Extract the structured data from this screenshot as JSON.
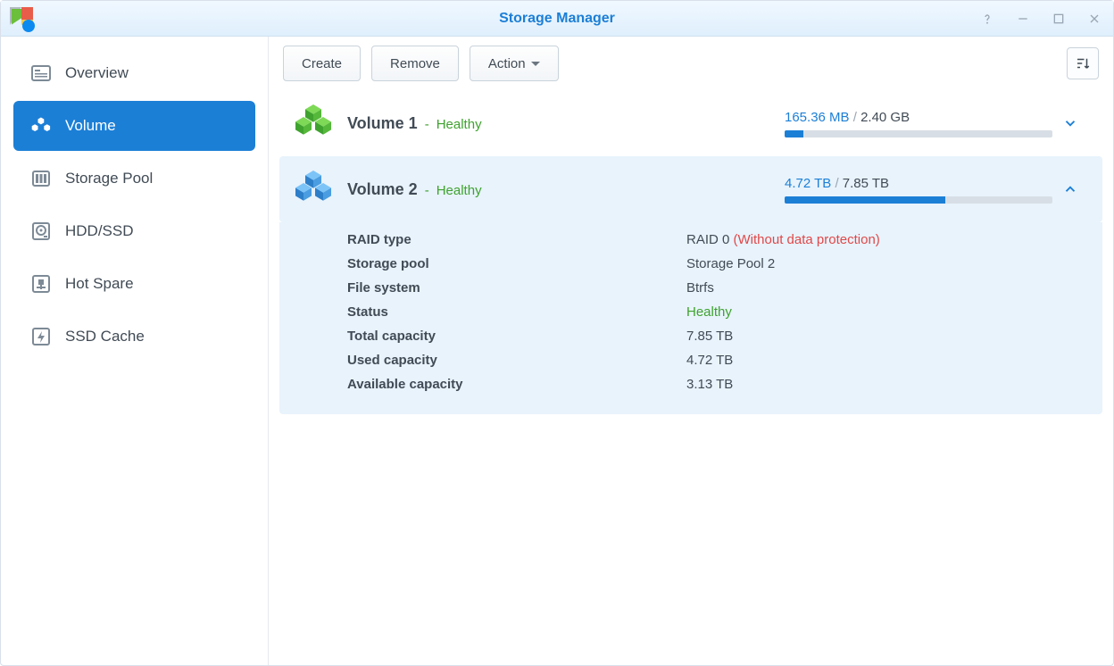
{
  "window": {
    "title": "Storage Manager"
  },
  "sidebar": {
    "items": [
      {
        "label": "Overview"
      },
      {
        "label": "Volume"
      },
      {
        "label": "Storage Pool"
      },
      {
        "label": "HDD/SSD"
      },
      {
        "label": "Hot Spare"
      },
      {
        "label": "SSD Cache"
      }
    ]
  },
  "toolbar": {
    "create": "Create",
    "remove": "Remove",
    "action": "Action"
  },
  "volumes": [
    {
      "name": "Volume 1",
      "status": "Healthy",
      "used": "165.36 MB",
      "total": "2.40 GB",
      "fill_pct": 7
    },
    {
      "name": "Volume 2",
      "status": "Healthy",
      "used": "4.72 TB",
      "total": "7.85 TB",
      "fill_pct": 60,
      "details": {
        "raid_type_label": "RAID type",
        "raid_type": "RAID 0",
        "raid_type_note": "(Without data protection)",
        "storage_pool_label": "Storage pool",
        "storage_pool": "Storage Pool 2",
        "fs_label": "File system",
        "fs": "Btrfs",
        "status_label": "Status",
        "status": "Healthy",
        "total_cap_label": "Total capacity",
        "total_cap": "7.85 TB",
        "used_cap_label": "Used capacity",
        "used_cap": "4.72 TB",
        "avail_cap_label": "Available capacity",
        "avail_cap": "3.13 TB"
      }
    }
  ]
}
